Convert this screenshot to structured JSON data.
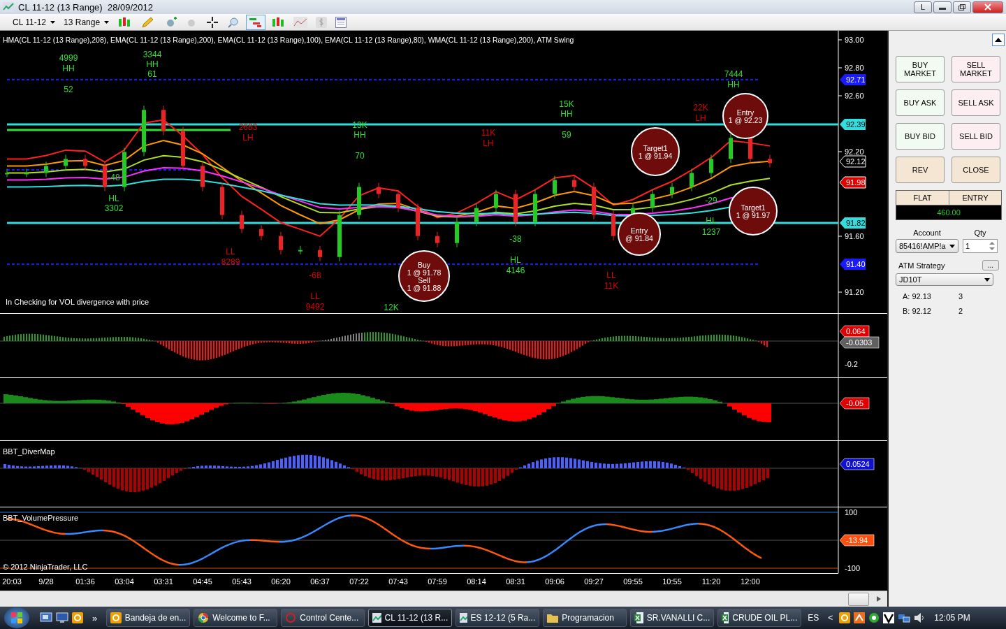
{
  "window": {
    "title": "CL 11-12 (13 Range)  28/09/2012",
    "buttons": [
      "L"
    ]
  },
  "toolbar": {
    "instrument": "CL 11-12",
    "interval": "13 Range"
  },
  "price_chart": {
    "legend": "HMA(CL 11-12 (13 Range),208), EMA(CL 11-12 (13 Range),200), EMA(CL 11-12 (13 Range),100), EMA(CL 11-12 (13 Range),80), WMA(CL 11-12 (13 Range),200), ATM Swing",
    "status": "In  Checking for VOL  divergence with price",
    "price_axis": [
      "93.00",
      "92.80",
      "92.60",
      "92.20",
      "91.60",
      "91.20"
    ],
    "price_levels": [
      {
        "label": "92.71",
        "color": "#1a1aff",
        "dashed": true
      },
      {
        "color": "#33dd33",
        "dashed": false
      },
      {
        "label": "92.39",
        "color": "#33dddd",
        "dashed": false
      },
      {
        "color": "#1a1aff",
        "dashed": true
      },
      {
        "label": "91.82",
        "color": "#33dddd",
        "dashed": false
      },
      {
        "label": "91.40",
        "color": "#1a1aff",
        "dashed": true
      }
    ],
    "price_tags": [
      {
        "label": "92.12",
        "color": "#000000"
      },
      {
        "label": "91.98",
        "color": "#e00000"
      }
    ],
    "swing_labels": [
      {
        "text": "4999",
        "color": "#33dd33"
      },
      {
        "text": "HH",
        "color": "#33dd33"
      },
      {
        "text": "52",
        "color": "#33dd33"
      },
      {
        "text": "3344",
        "color": "#33dd33"
      },
      {
        "text": "HH",
        "color": "#33dd33"
      },
      {
        "text": "61",
        "color": "#33dd33"
      },
      {
        "text": "-48",
        "color": "#33dd33"
      },
      {
        "text": "HL",
        "color": "#33dd33"
      },
      {
        "text": "3302",
        "color": "#33dd33"
      },
      {
        "text": "2683",
        "color": "#e00000"
      },
      {
        "text": "LH",
        "color": "#e00000"
      },
      {
        "text": "13K",
        "color": "#33dd33"
      },
      {
        "text": "HH",
        "color": "#33dd33"
      },
      {
        "text": "70",
        "color": "#33dd33"
      },
      {
        "text": "11K",
        "color": "#e00000"
      },
      {
        "text": "LH",
        "color": "#e00000"
      },
      {
        "text": "15K",
        "color": "#33dd33"
      },
      {
        "text": "HH",
        "color": "#33dd33"
      },
      {
        "text": "59",
        "color": "#33dd33"
      },
      {
        "text": "7444",
        "color": "#33dd33"
      },
      {
        "text": "HH",
        "color": "#33dd33"
      },
      {
        "text": "22K",
        "color": "#e00000"
      },
      {
        "text": "LH",
        "color": "#e00000"
      },
      {
        "text": "LL",
        "color": "#e00000"
      },
      {
        "text": "8289",
        "color": "#e00000"
      },
      {
        "text": "-68",
        "color": "#e00000"
      },
      {
        "text": "LL",
        "color": "#e00000"
      },
      {
        "text": "9492",
        "color": "#e00000"
      },
      {
        "text": "-38",
        "color": "#33dd33"
      },
      {
        "text": "HL",
        "color": "#33dd33"
      },
      {
        "text": "4146",
        "color": "#33dd33"
      },
      {
        "text": "LL",
        "color": "#e00000"
      },
      {
        "text": "11K",
        "color": "#e00000"
      },
      {
        "text": "-29",
        "color": "#33dd33"
      },
      {
        "text": "HL",
        "color": "#33dd33"
      },
      {
        "text": "1237",
        "color": "#33dd33"
      },
      {
        "text": "12K",
        "color": "#33dd33"
      }
    ],
    "trade_markers": [
      {
        "lines": [
          "Buy",
          "1 @ 91.78",
          "Sell",
          "1 @ 91.88"
        ]
      },
      {
        "lines": [
          "Target1",
          "1 @ 91.94"
        ]
      },
      {
        "lines": [
          "Entry",
          "@ 91.84"
        ]
      },
      {
        "lines": [
          "Entry",
          "1 @ 92.23"
        ]
      },
      {
        "lines": [
          "Target1",
          "1 @ 91.97"
        ]
      }
    ]
  },
  "indicator_panels": [
    {
      "axis_labels": [
        {
          "kind": "tag",
          "text": "0.064",
          "color": "#e00000"
        },
        {
          "kind": "tag",
          "text": "-0.0303",
          "color": "#606060"
        },
        {
          "kind": "tick",
          "text": "-0.2"
        }
      ]
    },
    {
      "axis_labels": [
        {
          "kind": "tag",
          "text": "-0.05",
          "color": "#e00000"
        }
      ]
    },
    {
      "title": "BBT_DiverMap",
      "axis_labels": [
        {
          "kind": "tag",
          "text": "0.0524",
          "color": "#1010d0"
        }
      ]
    },
    {
      "title": "BBT_VolumePressure",
      "axis_labels": [
        {
          "kind": "tick",
          "text": "100"
        },
        {
          "kind": "tag",
          "text": "-13.94",
          "color": "#ff5010"
        },
        {
          "kind": "tick",
          "text": "-100"
        }
      ]
    }
  ],
  "copyright": "© 2012 NinjaTrader, LLC",
  "time_axis": [
    "20:03",
    "9/28",
    "01:36",
    "03:04",
    "03:31",
    "04:45",
    "05:43",
    "06:20",
    "06:37",
    "07:22",
    "07:43",
    "07:59",
    "08:14",
    "08:31",
    "09:06",
    "09:27",
    "09:55",
    "10:55",
    "11:20",
    "12:00"
  ],
  "order_panel": {
    "buttons": [
      {
        "label": "BUY MARKET",
        "kind": "buy"
      },
      {
        "label": "SELL MARKET",
        "kind": "sell"
      },
      {
        "label": "BUY ASK",
        "kind": "buy"
      },
      {
        "label": "SELL ASK",
        "kind": "sell"
      },
      {
        "label": "BUY BID",
        "kind": "buy"
      },
      {
        "label": "SELL BID",
        "kind": "sell"
      },
      {
        "label": "REV",
        "kind": "neutral"
      },
      {
        "label": "CLOSE",
        "kind": "neutral"
      }
    ],
    "position": "FLAT",
    "position_header": "ENTRY",
    "pnl": "460.00",
    "account_label": "Account",
    "account": "85416!AMP!a",
    "qty_label": "Qty",
    "qty": "1",
    "atm_label": "ATM Strategy",
    "atm_button": "...",
    "atm": "JD10T",
    "quotes": [
      {
        "label": "A: 92.13",
        "size": "3"
      },
      {
        "label": "B: 92.12",
        "size": "2"
      }
    ]
  },
  "taskbar": {
    "quick_launch_more": "»",
    "items": [
      {
        "label": "Bandeja de en...",
        "kind": "mail",
        "selected": false
      },
      {
        "label": "Welcome to F...",
        "kind": "browser",
        "selected": false
      },
      {
        "label": "Control Cente...",
        "kind": "app",
        "selected": false
      },
      {
        "label": "CL 11-12 (13 R...",
        "kind": "chart",
        "selected": true
      },
      {
        "label": "ES 12-12 (5 Ra...",
        "kind": "chart",
        "selected": false
      },
      {
        "label": "Programacion",
        "kind": "folder",
        "selected": false
      },
      {
        "label": "SR.VANALLI C...",
        "kind": "sheet",
        "selected": false
      },
      {
        "label": "CRUDE OIL PL...",
        "kind": "sheet",
        "selected": false
      }
    ],
    "language": "ES",
    "tray_expand": "<",
    "clock": "12:05 PM"
  }
}
